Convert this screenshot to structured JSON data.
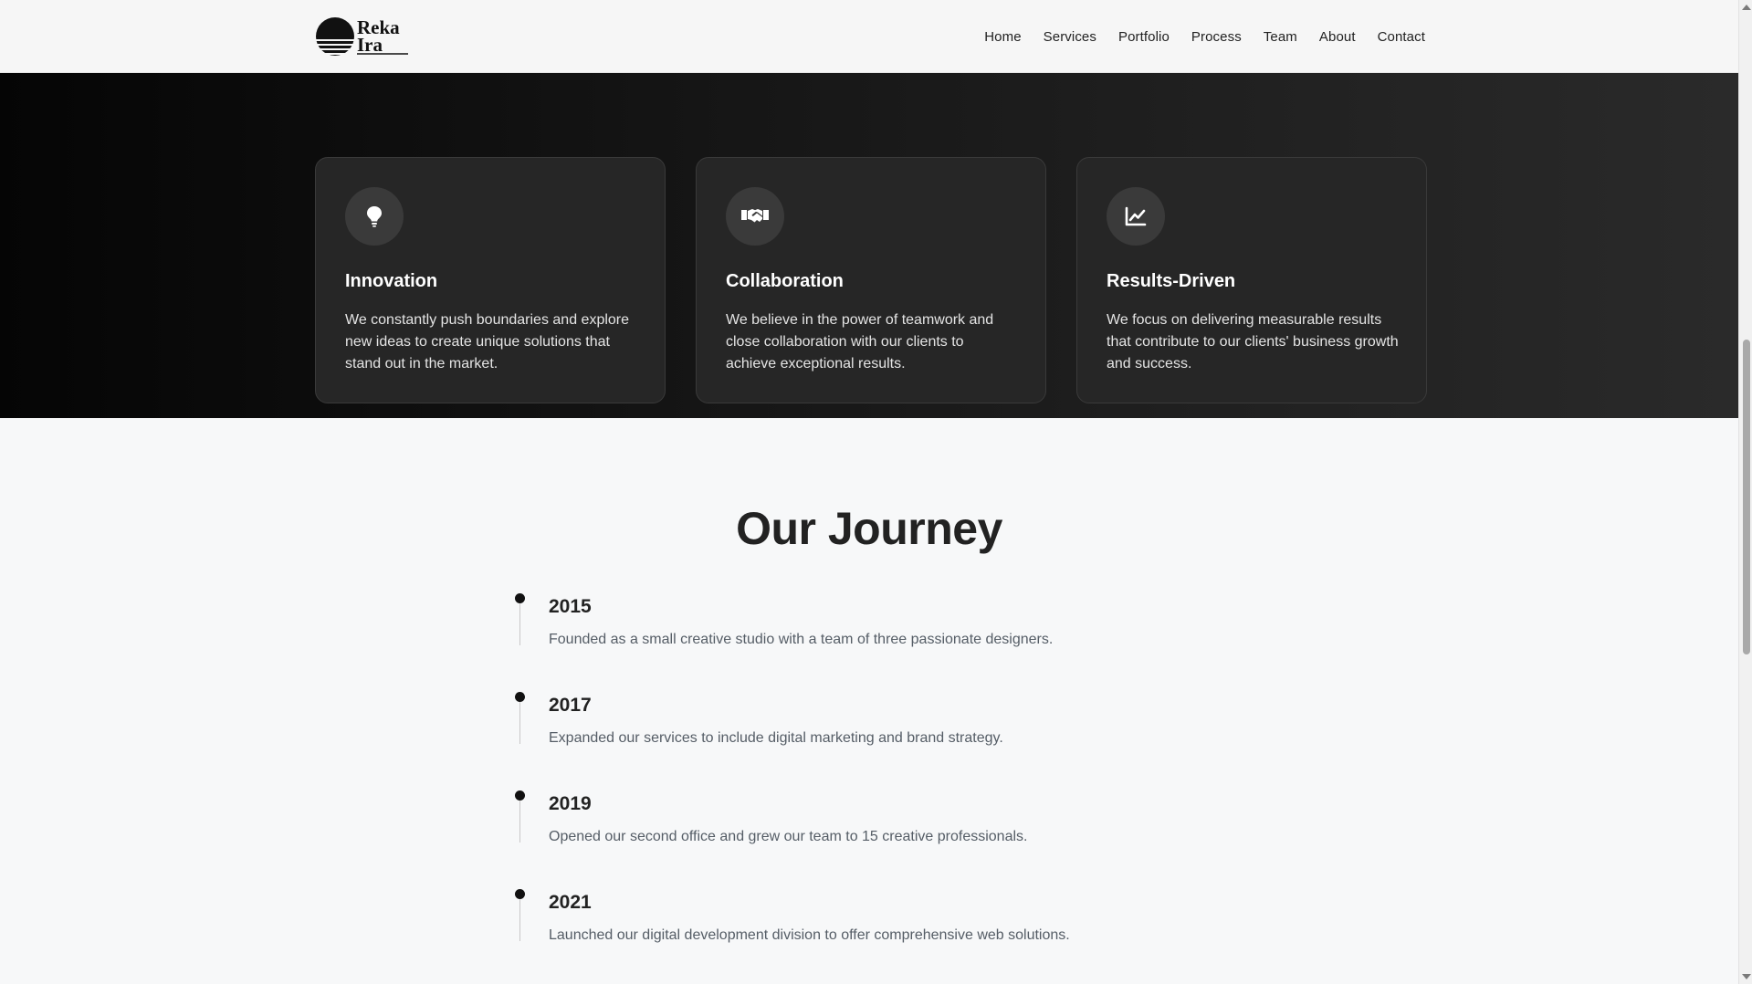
{
  "header": {
    "logo_text_line1": "Reka",
    "logo_text_line2": "Ira",
    "nav": [
      "Home",
      "Services",
      "Portfolio",
      "Process",
      "Team",
      "About",
      "Contact"
    ]
  },
  "values": {
    "cards": [
      {
        "icon": "lightbulb-icon",
        "title": "Innovation",
        "text": "We constantly push boundaries and explore new ideas to create unique solutions that stand out in the market."
      },
      {
        "icon": "handshake-icon",
        "title": "Collaboration",
        "text": "We believe in the power of teamwork and close collaboration with our clients to achieve exceptional results."
      },
      {
        "icon": "chart-line-icon",
        "title": "Results-Driven",
        "text": "We focus on delivering measurable results that contribute to our clients' business growth and success."
      }
    ]
  },
  "journey": {
    "title": "Our Journey",
    "items": [
      {
        "year": "2015",
        "text": "Founded as a small creative studio with a team of three passionate designers."
      },
      {
        "year": "2017",
        "text": "Expanded our services to include digital marketing and brand strategy."
      },
      {
        "year": "2019",
        "text": "Opened our second office and grew our team to 15 creative professionals."
      },
      {
        "year": "2021",
        "text": "Launched our digital development division to offer comprehensive web solutions."
      }
    ]
  },
  "colors": {
    "dark_section": "#151515",
    "card_bg": "#262626",
    "light_section": "#f7f8f9",
    "accent_dark": "#111111"
  }
}
